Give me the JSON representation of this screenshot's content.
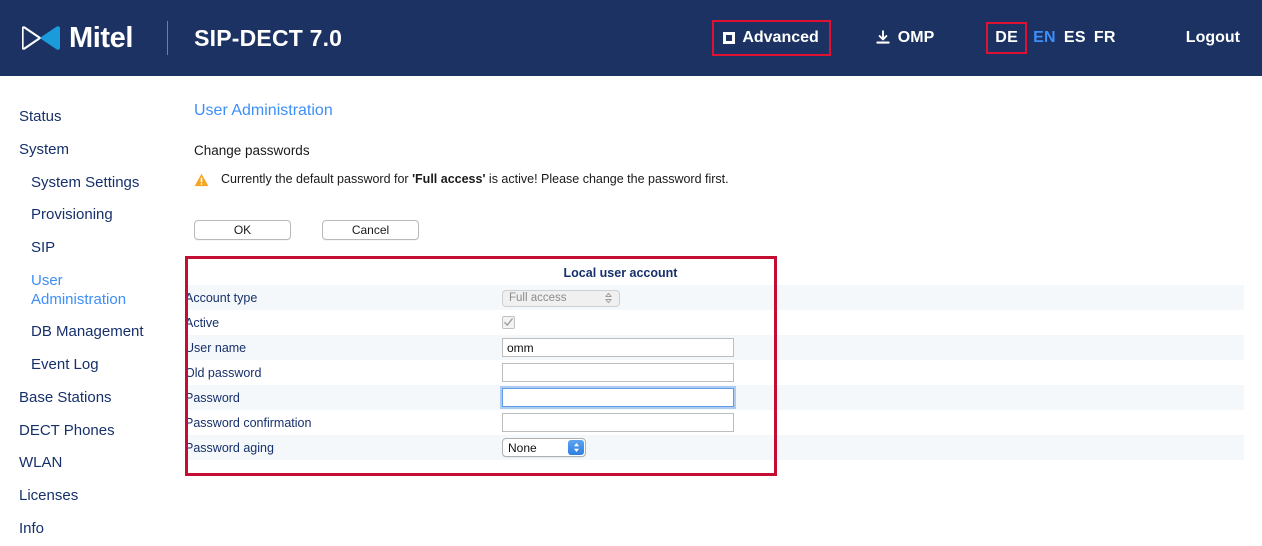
{
  "header": {
    "logo_name": "mitel-bowtie-logo",
    "brand": "Mitel",
    "product_title": "SIP-DECT 7.0",
    "advanced_label": "Advanced",
    "advanced_checkbox_state": "indeterminate",
    "omp_label": "OMP",
    "omp_icon": "download-icon",
    "logout_label": "Logout",
    "languages": [
      {
        "code": "DE",
        "active": false,
        "annotated": true
      },
      {
        "code": "EN",
        "active": true,
        "annotated": false
      },
      {
        "code": "ES",
        "active": false,
        "annotated": false
      },
      {
        "code": "FR",
        "active": false,
        "annotated": false
      }
    ]
  },
  "sidebar": {
    "items": [
      {
        "label": "Status",
        "sub": false,
        "active": false
      },
      {
        "label": "System",
        "sub": false,
        "active": false
      },
      {
        "label": "System Settings",
        "sub": true,
        "active": false
      },
      {
        "label": "Provisioning",
        "sub": true,
        "active": false
      },
      {
        "label": "SIP",
        "sub": true,
        "active": false
      },
      {
        "label": "User Administration",
        "sub": true,
        "active": true
      },
      {
        "label": "DB Management",
        "sub": true,
        "active": false
      },
      {
        "label": "Event Log",
        "sub": true,
        "active": false
      },
      {
        "label": "Base Stations",
        "sub": false,
        "active": false
      },
      {
        "label": "DECT Phones",
        "sub": false,
        "active": false
      },
      {
        "label": "WLAN",
        "sub": false,
        "active": false
      },
      {
        "label": "Licenses",
        "sub": false,
        "active": false
      },
      {
        "label": "Info",
        "sub": false,
        "active": false
      }
    ]
  },
  "main": {
    "page_title": "User Administration",
    "section_label": "Change passwords",
    "warning_icon": "warning-triangle-icon",
    "warning_prefix": "Currently the default password for ",
    "warning_bold": "'Full access'",
    "warning_suffix": " is active! Please change the password first.",
    "ok_label": "OK",
    "cancel_label": "Cancel",
    "column_header": "Local user account",
    "rows": [
      {
        "label": "Account type",
        "control": "select-disabled",
        "value": "Full access"
      },
      {
        "label": "Active",
        "control": "checkbox",
        "value": "checked"
      },
      {
        "label": "User name",
        "control": "text",
        "value": "omm"
      },
      {
        "label": "Old password",
        "control": "password",
        "value": ""
      },
      {
        "label": "Password",
        "control": "password-focused",
        "value": ""
      },
      {
        "label": "Password confirmation",
        "control": "password",
        "value": ""
      },
      {
        "label": "Password aging",
        "control": "select-popup",
        "value": "None"
      }
    ]
  },
  "colors": {
    "header_navy": "#1b3263",
    "link_blue": "#3d8ff7",
    "nav_text": "#16306b",
    "annotation_red": "#c30d33",
    "annotation_red_header": "#e11133",
    "row_stripe": "#f4f8fb",
    "warning_amber": "#f5a623"
  }
}
